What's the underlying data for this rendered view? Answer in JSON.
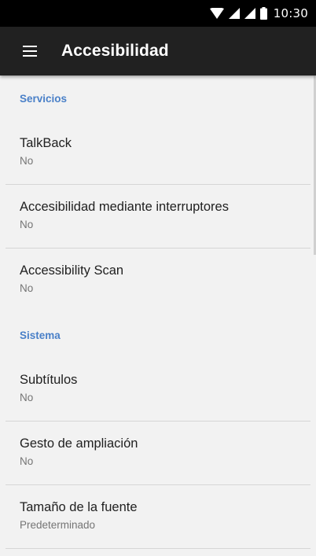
{
  "status_bar": {
    "time": "10:30",
    "icons": [
      "wifi-icon",
      "signal-icon",
      "signal-icon",
      "battery-icon"
    ]
  },
  "app_bar": {
    "menu_icon": "menu-icon",
    "title": "Accesibilidad"
  },
  "sections": [
    {
      "header": "Servicios",
      "items": [
        {
          "title": "TalkBack",
          "summary": "No"
        },
        {
          "title": "Accesibilidad mediante interruptores",
          "summary": "No"
        },
        {
          "title": "Accessibility Scan",
          "summary": "No"
        }
      ]
    },
    {
      "header": "Sistema",
      "items": [
        {
          "title": "Subtítulos",
          "summary": "No"
        },
        {
          "title": "Gesto de ampliación",
          "summary": "No"
        },
        {
          "title": "Tamaño de la fuente",
          "summary": "Predeterminado"
        }
      ]
    }
  ],
  "colors": {
    "status_bar": "#000000",
    "app_bar": "#212121",
    "background": "#f2f2f2",
    "section_header": "#4a80c8"
  }
}
